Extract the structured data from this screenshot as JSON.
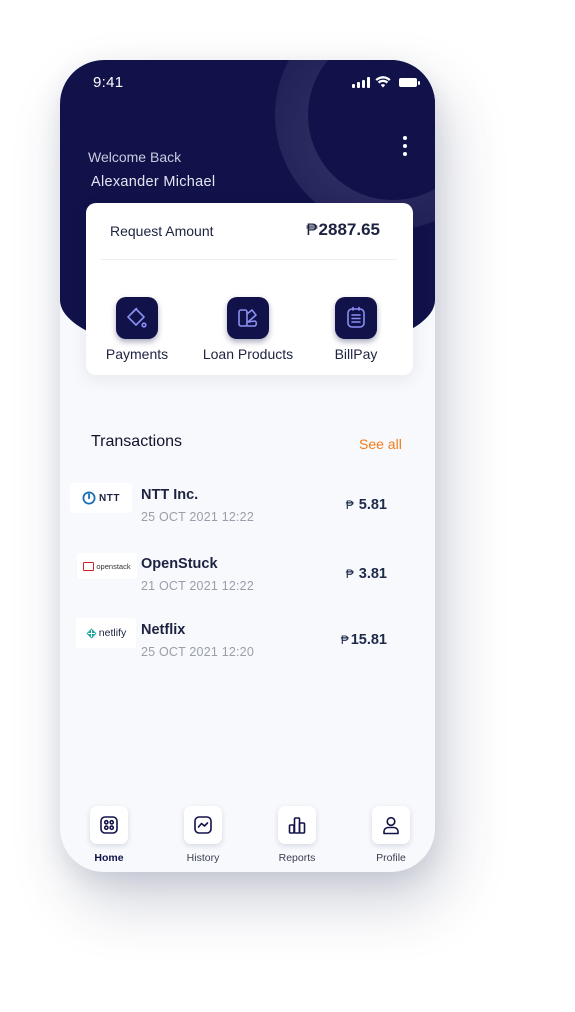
{
  "status_bar": {
    "time": "9:41"
  },
  "header": {
    "welcome": "Welcome Back",
    "user_name": "Alexander Michael"
  },
  "request_card": {
    "label": "Request Amount",
    "currency": "₱",
    "amount": "2887.65"
  },
  "actions": [
    {
      "label": "Payments",
      "icon": "payments-icon"
    },
    {
      "label": "Loan Products",
      "icon": "loan-products-icon"
    },
    {
      "label": "BillPay",
      "icon": "billpay-icon"
    }
  ],
  "transactions": {
    "title": "Transactions",
    "see_all": "See all",
    "items": [
      {
        "name": "NTT Inc.",
        "date": "25 OCT 2021 12:22",
        "currency": "₱",
        "amount": "5.81",
        "logo_text": "NTT"
      },
      {
        "name": "OpenStuck",
        "date": "21 OCT 2021 12:22",
        "currency": "₱",
        "amount": "3.81",
        "logo_text": "openstack"
      },
      {
        "name": "Netflix",
        "date": "25 OCT 2021 12:20",
        "currency": "₱",
        "amount": "15.81",
        "logo_text": "netlify"
      }
    ]
  },
  "tabbar": [
    {
      "label": "Home",
      "icon": "home-icon",
      "active": true
    },
    {
      "label": "History",
      "icon": "history-icon",
      "active": false
    },
    {
      "label": "Reports",
      "icon": "reports-icon",
      "active": false
    },
    {
      "label": "Profile",
      "icon": "profile-icon",
      "active": false
    }
  ],
  "colors": {
    "primary_navy": "#12124a",
    "accent_orange": "#f07c1f",
    "background": "#f7f9fc"
  }
}
